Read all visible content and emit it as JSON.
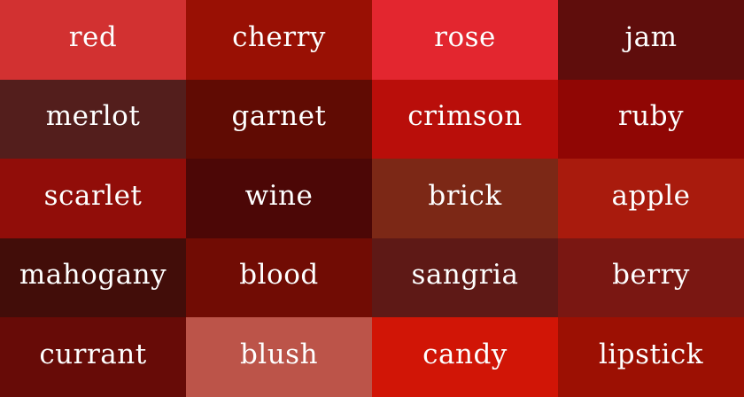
{
  "swatches": [
    {
      "name": "red",
      "color": "#d23131"
    },
    {
      "name": "cherry",
      "color": "#991004"
    },
    {
      "name": "rose",
      "color": "#e3262f"
    },
    {
      "name": "jam",
      "color": "#5f0d0c"
    },
    {
      "name": "merlot",
      "color": "#531e1c"
    },
    {
      "name": "garnet",
      "color": "#600b03"
    },
    {
      "name": "crimson",
      "color": "#b90e0a"
    },
    {
      "name": "ruby",
      "color": "#900604"
    },
    {
      "name": "scarlet",
      "color": "#910d09"
    },
    {
      "name": "wine",
      "color": "#4c0706"
    },
    {
      "name": "brick",
      "color": "#7c2816"
    },
    {
      "name": "apple",
      "color": "#a91b0d"
    },
    {
      "name": "mahogany",
      "color": "#420d09"
    },
    {
      "name": "blood",
      "color": "#710c04"
    },
    {
      "name": "sangria",
      "color": "#5e1916"
    },
    {
      "name": "berry",
      "color": "#7a1712"
    },
    {
      "name": "currant",
      "color": "#670b07"
    },
    {
      "name": "blush",
      "color": "#bc5449"
    },
    {
      "name": "candy",
      "color": "#d11506"
    },
    {
      "name": "lipstick",
      "color": "#9c1003"
    }
  ]
}
